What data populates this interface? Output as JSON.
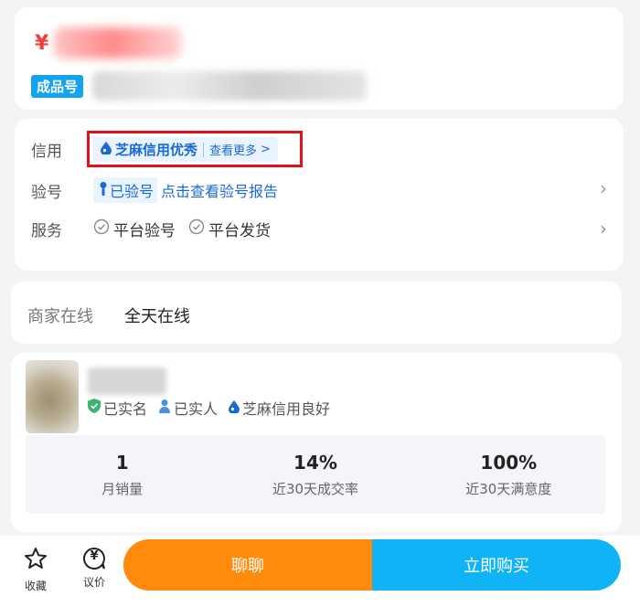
{
  "price": {
    "currency_symbol": "¥"
  },
  "product": {
    "badge": "成品号"
  },
  "info": {
    "credit": {
      "label": "信用",
      "value": "芝麻信用优秀",
      "more": "查看更多",
      "more_chevron": ">"
    },
    "verify": {
      "label": "验号",
      "tag": "已验号",
      "link": "点击查看验号报告"
    },
    "service": {
      "label": "服务",
      "items": [
        "平台验号",
        "平台发货"
      ]
    },
    "chevron": "›"
  },
  "online": {
    "label": "商家在线",
    "value": "全天在线"
  },
  "seller": {
    "tags": [
      "已实名",
      "已实人",
      "芝麻信用良好"
    ],
    "stats": [
      {
        "value": "1",
        "label": "月销量"
      },
      {
        "value": "14%",
        "label": "近30天成交率"
      },
      {
        "value": "100%",
        "label": "近30天满意度"
      }
    ]
  },
  "bottom": {
    "favorite": "收藏",
    "negotiate": "议价",
    "negotiate_icon_glyph": "¥",
    "chat": "聊聊",
    "buy": "立即购买"
  },
  "colors": {
    "price_red": "#f23c3c",
    "badge_blue": "#13a4ef",
    "link_blue": "#1a6ad6",
    "highlight_red": "#e3101b",
    "chat_orange": "#ff8a0c",
    "buy_blue": "#10b4f6"
  },
  "icons": {
    "credit": "sesame-drop-icon",
    "verify": "person-icon",
    "service": "check-circle-icon",
    "seller_verified": "shield-check-icon",
    "seller_person": "person-icon",
    "seller_credit": "sesame-drop-icon",
    "favorite": "star-icon",
    "negotiate": "yuan-bubble-icon"
  }
}
